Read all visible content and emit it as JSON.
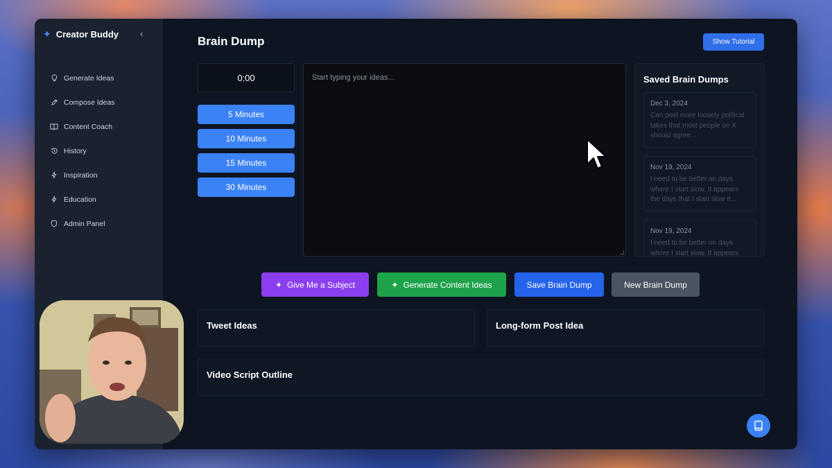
{
  "app": {
    "brand": "Creator Buddy",
    "collapse_icon": "chevron-left-icon"
  },
  "sidebar": {
    "items": [
      {
        "label": "Generate Ideas",
        "icon": "lightbulb-icon"
      },
      {
        "label": "Compose Ideas",
        "icon": "pen-icon"
      },
      {
        "label": "Content Coach",
        "icon": "book-open-icon"
      },
      {
        "label": "History",
        "icon": "history-icon"
      },
      {
        "label": "Inspiration",
        "icon": "lightning-icon"
      },
      {
        "label": "Education",
        "icon": "lightning-icon"
      },
      {
        "label": "Admin Panel",
        "icon": "shield-icon"
      }
    ]
  },
  "header": {
    "title": "Brain Dump",
    "tutorial_label": "Show Tutorial"
  },
  "timer": {
    "value": "0:00",
    "durations": [
      "5 Minutes",
      "10 Minutes",
      "15 Minutes",
      "30 Minutes"
    ]
  },
  "editor": {
    "placeholder": "Start typing your ideas..."
  },
  "saved": {
    "title": "Saved Brain Dumps",
    "items": [
      {
        "date": "Dec 3, 2024",
        "preview": "Can post more loosely political takes that most people on X should agree..."
      },
      {
        "date": "Nov 19, 2024",
        "preview": "I need to be better on days where I start slow. It appears the days that I start slow it..."
      },
      {
        "date": "Nov 19, 2024",
        "preview": "I need to be better on days where I start slow. It appears"
      }
    ]
  },
  "actions": {
    "subject": "Give Me a Subject",
    "generate": "Generate Content Ideas",
    "save": "Save Brain Dump",
    "new": "New Brain Dump"
  },
  "panels": {
    "tweets": "Tweet Ideas",
    "longform": "Long-form Post Idea",
    "video": "Video Script Outline"
  },
  "colors": {
    "accent": "#3b82f6",
    "purple": "#8b3ff0",
    "green": "#1fa34a",
    "gray": "#4a5463"
  }
}
